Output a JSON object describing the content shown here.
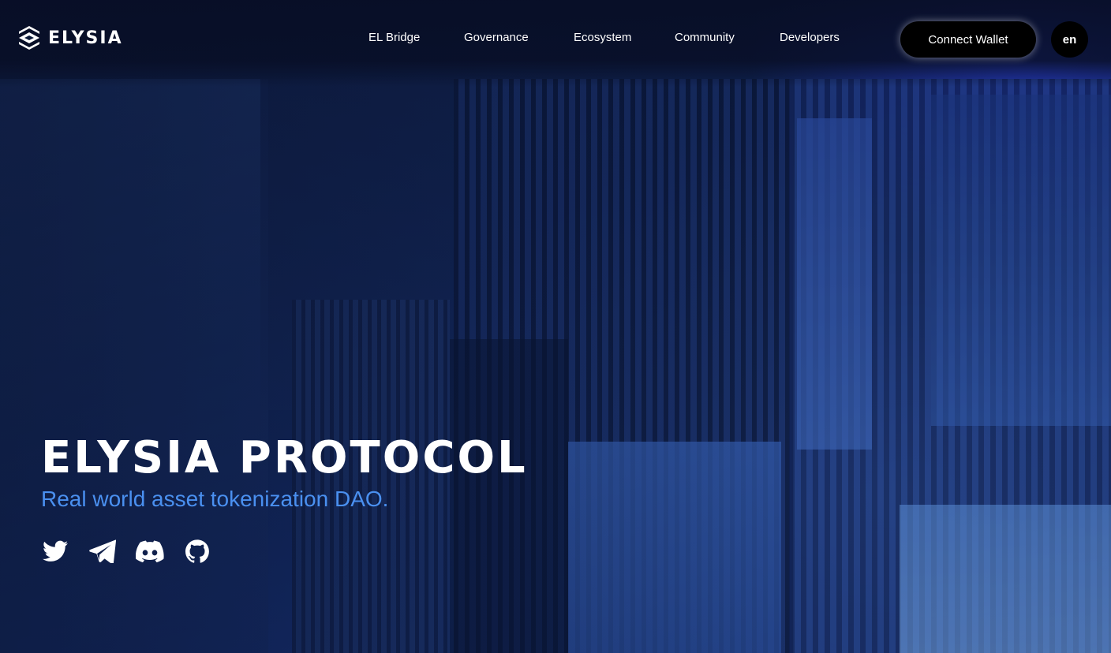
{
  "header": {
    "brand": "ELYSIA",
    "nav": [
      {
        "label": "EL Bridge"
      },
      {
        "label": "Governance"
      },
      {
        "label": "Ecosystem"
      },
      {
        "label": "Community"
      },
      {
        "label": "Developers"
      }
    ],
    "connect_label": "Connect Wallet",
    "lang_label": "en"
  },
  "hero": {
    "title": "ELYSIA PROTOCOL",
    "subtitle": "Real world asset tokenization DAO."
  },
  "socials": [
    {
      "icon": "twitter-icon"
    },
    {
      "icon": "telegram-icon"
    },
    {
      "icon": "discord-icon"
    },
    {
      "icon": "github-icon"
    }
  ],
  "colors": {
    "accent": "#4a90f0",
    "background": "#0f2250",
    "button": "#000000",
    "text": "#ffffff"
  }
}
